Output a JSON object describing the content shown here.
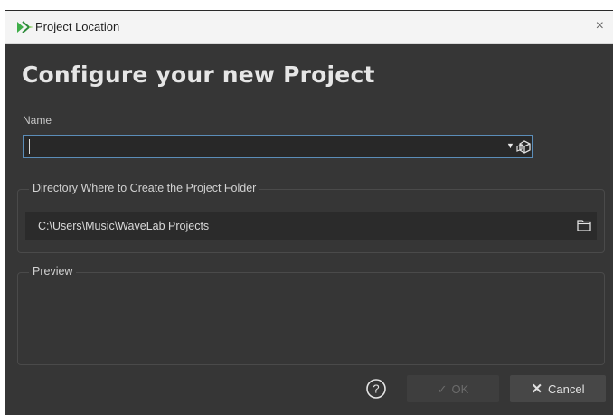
{
  "window": {
    "title": "Project Location",
    "close_label": "×"
  },
  "heading": "Configure your new Project",
  "name": {
    "label": "Name",
    "value": ""
  },
  "directory": {
    "legend": "Directory Where to Create the Project Folder",
    "path": "C:\\Users\\Music\\WaveLab Projects"
  },
  "preview": {
    "legend": "Preview"
  },
  "buttons": {
    "help": "?",
    "ok": "OK",
    "cancel": "Cancel"
  },
  "icons": {
    "app": "wavelab-logo-icon",
    "name_browse": "cube-browse-icon",
    "folder": "folder-icon",
    "ok": "check-icon",
    "cancel": "x-icon"
  },
  "colors": {
    "accent": "#5b8db8",
    "logo_green": "#3fae49"
  }
}
